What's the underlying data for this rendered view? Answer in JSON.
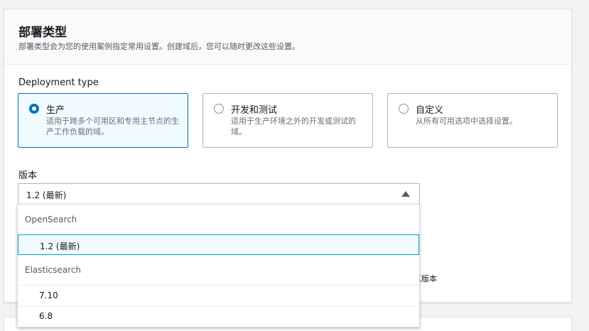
{
  "header": {
    "title": "部署类型",
    "description": "部署类型会为您的使用案例指定常用设置。创建域后，您可以随时更改这些设置。"
  },
  "deployment": {
    "label": "Deployment type",
    "options": [
      {
        "title": "生产",
        "description": "适用于跨多个可用区和专用主节点的生产工作负载的域。",
        "selected": true
      },
      {
        "title": "开发和测试",
        "description": "适用于生产环境之外的开发或测试的域。",
        "selected": false
      },
      {
        "title": "自定义",
        "description": "从所有可用选项中选择设置。",
        "selected": false
      }
    ]
  },
  "version": {
    "label": "版本",
    "selected": "1.2 (最新)",
    "partial_hidden_text": "择其版本",
    "groups": [
      {
        "label": "OpenSearch",
        "options": [
          "1.2 (最新)"
        ]
      },
      {
        "label": "Elasticsearch",
        "options": [
          "7.10",
          "6.8"
        ]
      }
    ]
  },
  "colors": {
    "accent": "#0073bb",
    "focus": "#00a1c9"
  }
}
